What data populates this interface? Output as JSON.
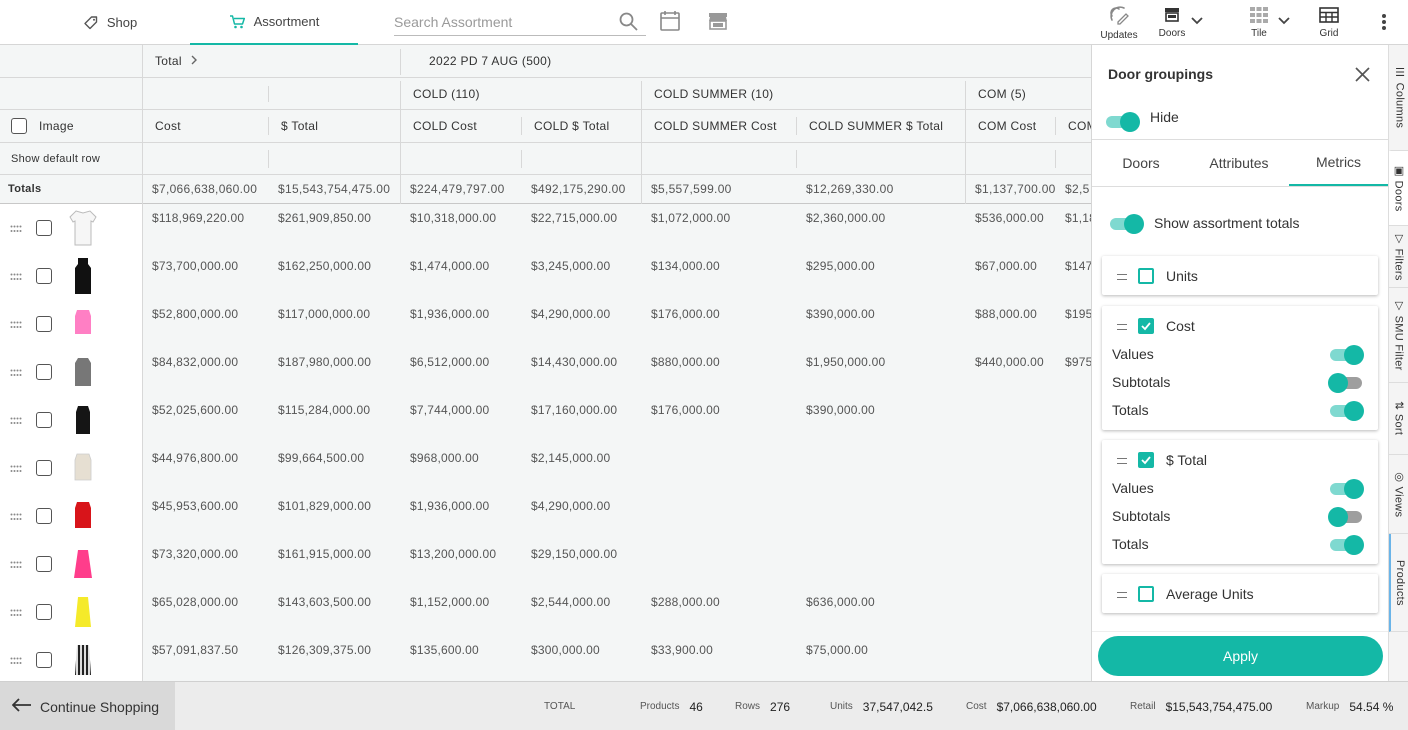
{
  "nav": {
    "shop_label": "Shop",
    "assortment_label": "Assortment",
    "search_placeholder": "Search Assortment",
    "updates_label": "Updates",
    "doors_label": "Doors",
    "tile_label": "Tile",
    "grid_label": "Grid"
  },
  "colors": {
    "accent": "#14b8a6",
    "accent_light": "#7fd9d0",
    "header_bg": "#f4f6f6"
  },
  "grid": {
    "total_label": "Total",
    "group_label": "2022 PD 7 AUG (500)",
    "subgroups": [
      "COLD (110)",
      "COLD SUMMER (10)",
      "COM (5)"
    ],
    "image_label": "Image",
    "columns": [
      "Cost",
      "$ Total",
      "COLD Cost",
      "COLD $ Total",
      "COLD SUMMER Cost",
      "COLD SUMMER $ Total",
      "COM Cost",
      "COM"
    ],
    "show_default_row": "Show default row",
    "totals_label": "Totals",
    "totals": [
      "$7,066,638,060.00",
      "$15,543,754,475.00",
      "$224,479,797.00",
      "$492,175,290.00",
      "$5,557,599.00",
      "$12,269,330.00",
      "$1,137,700.00",
      "$2,5"
    ],
    "rows": [
      {
        "item": "white-shirt",
        "values": [
          "$118,969,220.00",
          "$261,909,850.00",
          "$10,318,000.00",
          "$22,715,000.00",
          "$1,072,000.00",
          "$2,360,000.00",
          "$536,000.00",
          "$1,18"
        ]
      },
      {
        "item": "black-dress",
        "values": [
          "$73,700,000.00",
          "$162,250,000.00",
          "$1,474,000.00",
          "$3,245,000.00",
          "$134,000.00",
          "$295,000.00",
          "$67,000.00",
          "$147"
        ]
      },
      {
        "item": "pink-top",
        "values": [
          "$52,800,000.00",
          "$117,000,000.00",
          "$1,936,000.00",
          "$4,290,000.00",
          "$176,000.00",
          "$390,000.00",
          "$88,000.00",
          "$195"
        ]
      },
      {
        "item": "grey-tank",
        "values": [
          "$84,832,000.00",
          "$187,980,000.00",
          "$6,512,000.00",
          "$14,430,000.00",
          "$880,000.00",
          "$1,950,000.00",
          "$440,000.00",
          "$975"
        ]
      },
      {
        "item": "black-camisole",
        "values": [
          "$52,025,600.00",
          "$115,284,000.00",
          "$7,744,000.00",
          "$17,160,000.00",
          "$176,000.00",
          "$390,000.00",
          "",
          ""
        ]
      },
      {
        "item": "beige-top",
        "values": [
          "$44,976,800.00",
          "$99,664,500.00",
          "$968,000.00",
          "$2,145,000.00",
          "",
          "",
          "",
          ""
        ]
      },
      {
        "item": "red-camisole",
        "values": [
          "$45,953,600.00",
          "$101,829,000.00",
          "$1,936,000.00",
          "$4,290,000.00",
          "",
          "",
          "",
          ""
        ]
      },
      {
        "item": "pink-slip-dress",
        "values": [
          "$73,320,000.00",
          "$161,915,000.00",
          "$13,200,000.00",
          "$29,150,000.00",
          "",
          "",
          "",
          ""
        ]
      },
      {
        "item": "yellow-dress",
        "values": [
          "$65,028,000.00",
          "$143,603,500.00",
          "$1,152,000.00",
          "$2,544,000.00",
          "$288,000.00",
          "$636,000.00",
          "",
          ""
        ]
      },
      {
        "item": "striped-dress",
        "values": [
          "$57,091,837.50",
          "$126,309,375.00",
          "$135,600.00",
          "$300,000.00",
          "$33,900.00",
          "$75,000.00",
          "",
          ""
        ]
      }
    ]
  },
  "panel": {
    "title": "Door groupings",
    "hide_label": "Hide",
    "tabs": [
      "Doors",
      "Attributes",
      "Metrics"
    ],
    "active_tab": "Metrics",
    "show_totals_label": "Show assortment totals",
    "metrics": [
      {
        "label": "Units",
        "checked": false,
        "options": []
      },
      {
        "label": "Cost",
        "checked": true,
        "options": [
          {
            "label": "Values",
            "on": true
          },
          {
            "label": "Subtotals",
            "on": false
          },
          {
            "label": "Totals",
            "on": true
          }
        ]
      },
      {
        "label": "$ Total",
        "checked": true,
        "options": [
          {
            "label": "Values",
            "on": true
          },
          {
            "label": "Subtotals",
            "on": false
          },
          {
            "label": "Totals",
            "on": true
          }
        ]
      },
      {
        "label": "Average Units",
        "checked": false,
        "options": []
      }
    ],
    "apply_label": "Apply"
  },
  "sidetabs": [
    "Columns",
    "Doors",
    "Filters",
    "SMU Filter",
    "Sort",
    "Views",
    "Products"
  ],
  "footer": {
    "continue_label": "Continue Shopping",
    "total_label": "TOTAL",
    "products_label": "Products",
    "products_value": "46",
    "rows_label": "Rows",
    "rows_value": "276",
    "units_label": "Units",
    "units_value": "37,547,042.5",
    "cost_label": "Cost",
    "cost_value": "$7,066,638,060.00",
    "retail_label": "Retail",
    "retail_value": "$15,543,754,475.00",
    "markup_label": "Markup",
    "markup_value": "54.54 %"
  }
}
